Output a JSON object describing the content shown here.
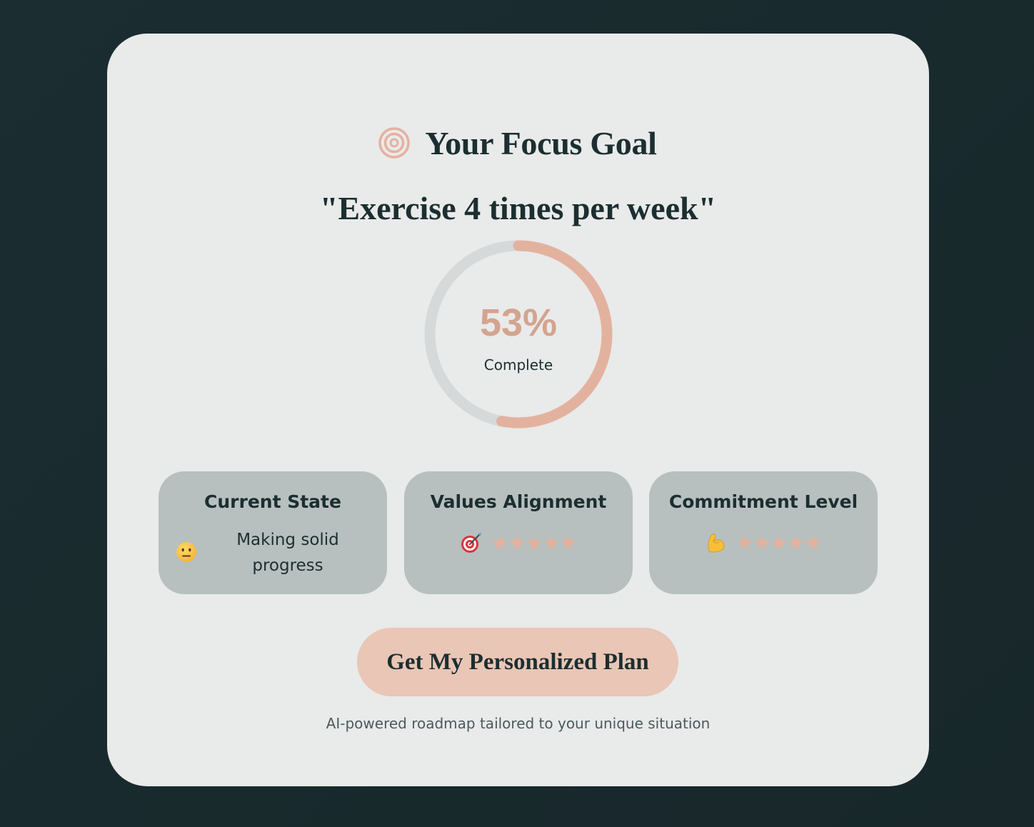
{
  "header": {
    "icon": "target-icon",
    "title": "Your Focus Goal"
  },
  "goal": {
    "text": "\"Exercise 4 times per week\""
  },
  "progress": {
    "value": 0.53,
    "percent_label": "53%",
    "label": "Complete"
  },
  "tiles": {
    "current_state": {
      "title": "Current State",
      "emoji": "neutral-face-icon",
      "text": "Making solid progress"
    },
    "values_alignment": {
      "title": "Values Alignment",
      "icon": "bullseye-dart-icon",
      "rating": 5,
      "max": 5
    },
    "commitment_level": {
      "title": "Commitment Level",
      "icon": "flexed-biceps-icon",
      "rating": 5,
      "max": 5
    }
  },
  "cta": {
    "label": "Get My Personalized Plan"
  },
  "subtitle": "AI-powered roadmap tailored to your unique situation",
  "colors": {
    "background": "#1b2d31",
    "card": "#e9eaea",
    "accent": "#e3b29f",
    "tile": "#b7c0bf",
    "text": "#1c2e30",
    "button": "#e9c6b6"
  }
}
